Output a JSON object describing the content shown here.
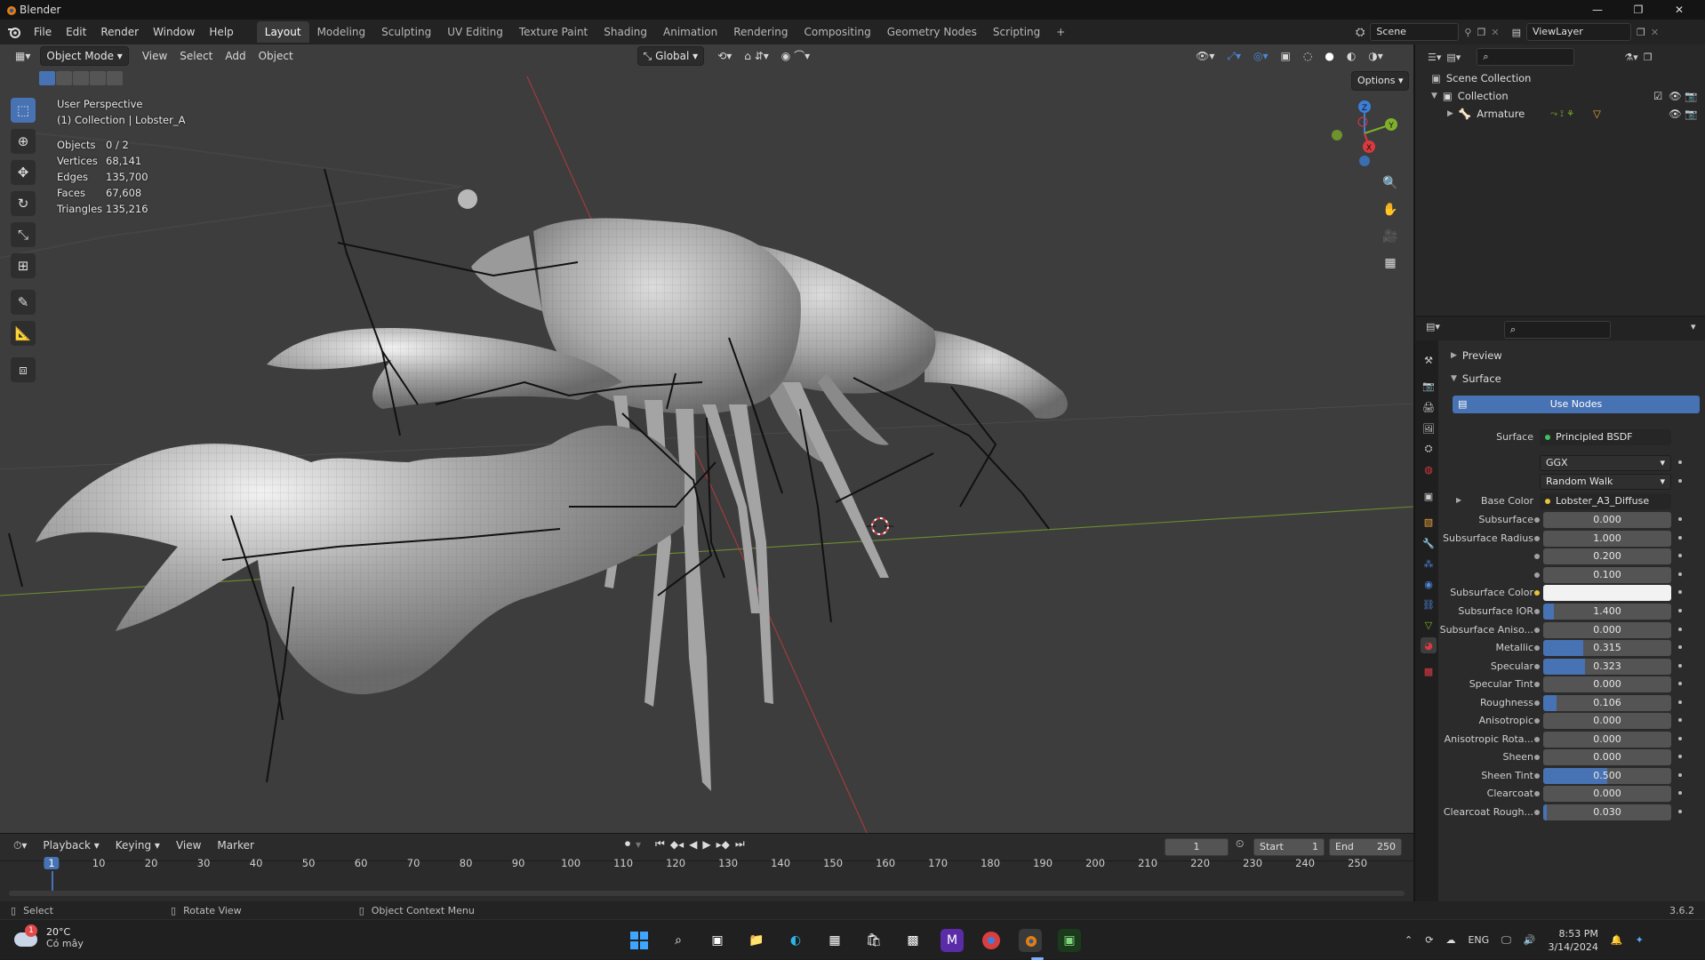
{
  "window": {
    "title": "Blender",
    "controls": [
      "—",
      "❐",
      "✕"
    ]
  },
  "menu": [
    "File",
    "Edit",
    "Render",
    "Window",
    "Help"
  ],
  "workspaces": [
    "Layout",
    "Modeling",
    "Sculpting",
    "UV Editing",
    "Texture Paint",
    "Shading",
    "Animation",
    "Rendering",
    "Compositing",
    "Geometry Nodes",
    "Scripting"
  ],
  "workspace_add": "+",
  "scene": {
    "name": "Scene",
    "view_layer": "ViewLayer"
  },
  "viewport_header": {
    "mode": "Object Mode",
    "menus": [
      "View",
      "Select",
      "Add",
      "Object"
    ],
    "transform_orientation": "Global",
    "options_label": "Options"
  },
  "viewport_info": {
    "perspective": "User Perspective",
    "collection": "(1) Collection | Lobster_A",
    "stats": [
      {
        "label": "Objects",
        "value": "0 / 2"
      },
      {
        "label": "Vertices",
        "value": "68,141"
      },
      {
        "label": "Edges",
        "value": "135,700"
      },
      {
        "label": "Faces",
        "value": "67,608"
      },
      {
        "label": "Triangles",
        "value": "135,216"
      }
    ]
  },
  "gizmo_axes": {
    "z": "Z",
    "y": "Y",
    "x": "X"
  },
  "outliner": {
    "scene_collection": "Scene Collection",
    "collection": "Collection",
    "armature": "Armature"
  },
  "properties": {
    "panels": {
      "preview": "Preview",
      "surface": "Surface"
    },
    "use_nodes": "Use Nodes",
    "surface_label": "Surface",
    "surface_node": "Principled BSDF",
    "distribution": "GGX",
    "subsurface_method": "Random Walk",
    "base_color_label": "Base Color",
    "base_color_node": "Lobster_A3_Diffuse",
    "subsurface_color_label": "Subsurface Color",
    "subsurface_color": "#f2f2f2",
    "rows": [
      {
        "label": "Subsurface",
        "value": "0.000",
        "fill": 0
      },
      {
        "label": "Subsurface Radius",
        "value": "1.000",
        "fill": 0
      },
      {
        "label": "",
        "value": "0.200",
        "fill": 0
      },
      {
        "label": "",
        "value": "0.100",
        "fill": 0
      },
      {
        "label": "Subsurface IOR",
        "value": "1.400",
        "fill": 0.08
      },
      {
        "label": "Subsurface Aniso...",
        "value": "0.000",
        "fill": 0
      },
      {
        "label": "Metallic",
        "value": "0.315",
        "fill": 0.315
      },
      {
        "label": "Specular",
        "value": "0.323",
        "fill": 0.323
      },
      {
        "label": "Specular Tint",
        "value": "0.000",
        "fill": 0
      },
      {
        "label": "Roughness",
        "value": "0.106",
        "fill": 0.106
      },
      {
        "label": "Anisotropic",
        "value": "0.000",
        "fill": 0
      },
      {
        "label": "Anisotropic Rota...",
        "value": "0.000",
        "fill": 0
      },
      {
        "label": "Sheen",
        "value": "0.000",
        "fill": 0
      },
      {
        "label": "Sheen Tint",
        "value": "0.500",
        "fill": 0.5
      },
      {
        "label": "Clearcoat",
        "value": "0.000",
        "fill": 0
      },
      {
        "label": "Clearcoat Rough...",
        "value": "0.030",
        "fill": 0.03
      }
    ]
  },
  "timeline": {
    "menus": [
      "Playback",
      "Keying",
      "View",
      "Marker"
    ],
    "current_frame": "1",
    "start_label": "Start",
    "start": "1",
    "end_label": "End",
    "end": "250",
    "ruler": [
      "1",
      "10",
      "20",
      "30",
      "40",
      "50",
      "60",
      "70",
      "80",
      "90",
      "100",
      "110",
      "120",
      "130",
      "140",
      "150",
      "160",
      "170",
      "180",
      "190",
      "200",
      "210",
      "220",
      "230",
      "240",
      "250"
    ]
  },
  "statusbar": {
    "select": "Select",
    "rotate": "Rotate View",
    "context": "Object Context Menu",
    "version": "3.6.2"
  },
  "taskbar": {
    "weather_temp": "20°C",
    "weather_desc": "Có mây",
    "weather_badge": "1",
    "language": "ENG",
    "time": "8:53 PM",
    "date": "3/14/2024"
  },
  "colors": {
    "accent": "#4772b3",
    "x_axis": "#d9393f",
    "y_axis": "#7fb02a",
    "z_axis": "#3b7fd8",
    "viewport_bg": "#3d3d3d"
  }
}
